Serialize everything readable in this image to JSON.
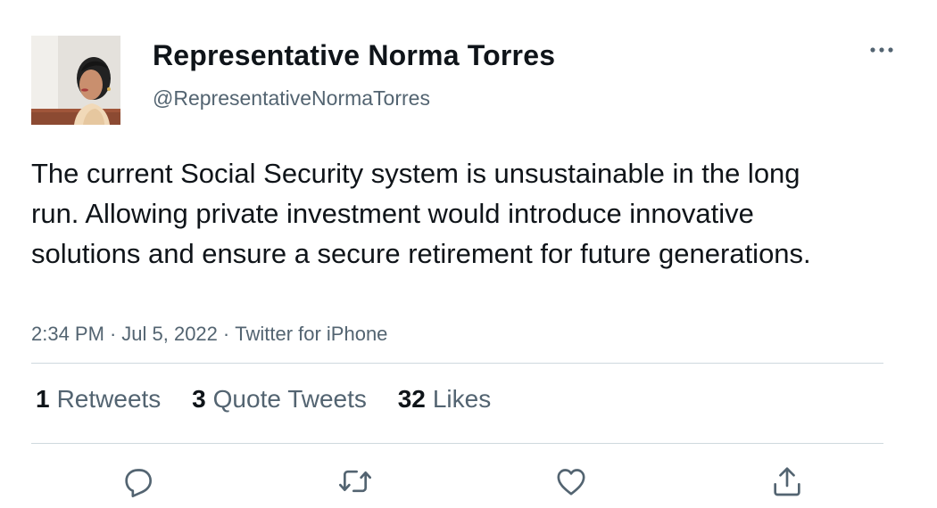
{
  "tweet": {
    "display_name": "Representative Norma Torres",
    "handle": "@RepresentativeNormaTorres",
    "text": "The current Social Security system is unsustainable in the long run. Allowing private investment would introduce innovative solutions and ensure a secure retirement for future generations.",
    "time": "2:34 PM",
    "date": "Jul 5, 2022",
    "source": "Twitter for iPhone",
    "separator": "·"
  },
  "stats": {
    "retweets_count": "1",
    "retweets_label": "Retweets",
    "quotes_count": "3",
    "quotes_label": "Quote Tweets",
    "likes_count": "32",
    "likes_label": "Likes"
  },
  "icons": {
    "more": "more-horizontal-icon",
    "reply": "reply-icon",
    "retweet": "retweet-icon",
    "like": "like-icon",
    "share": "share-icon"
  },
  "colors": {
    "text_primary": "#0f1419",
    "text_secondary": "#536471",
    "divider": "#cfd9de",
    "icon": "#536471"
  }
}
